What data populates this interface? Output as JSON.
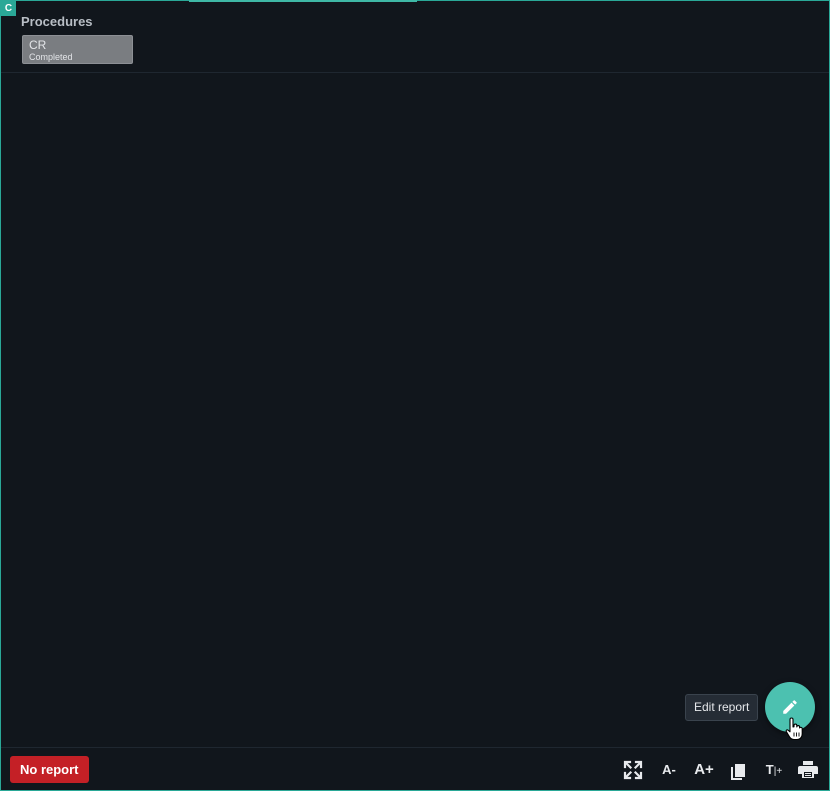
{
  "panel": {
    "badge_letter": "C",
    "accent_color": "#2aa897"
  },
  "header": {
    "title": "Procedures",
    "procedure_chip": {
      "modality": "CR",
      "status": "Completed"
    }
  },
  "fab": {
    "icon": "pencil-icon",
    "tooltip": "Edit report",
    "color": "#4cc1b0"
  },
  "footer": {
    "no_report_label": "No report",
    "no_report_color": "#c42026",
    "tools": [
      {
        "name": "fullscreen",
        "icon": "fullscreen-icon"
      },
      {
        "name": "font-decrease",
        "icon": "font-decrease-icon",
        "label": "A-"
      },
      {
        "name": "font-increase",
        "icon": "font-increase-icon",
        "label": "A+"
      },
      {
        "name": "copy",
        "icon": "copy-icon"
      },
      {
        "name": "text-size",
        "icon": "text-size-icon",
        "label": "T"
      },
      {
        "name": "print",
        "icon": "print-icon"
      }
    ]
  }
}
